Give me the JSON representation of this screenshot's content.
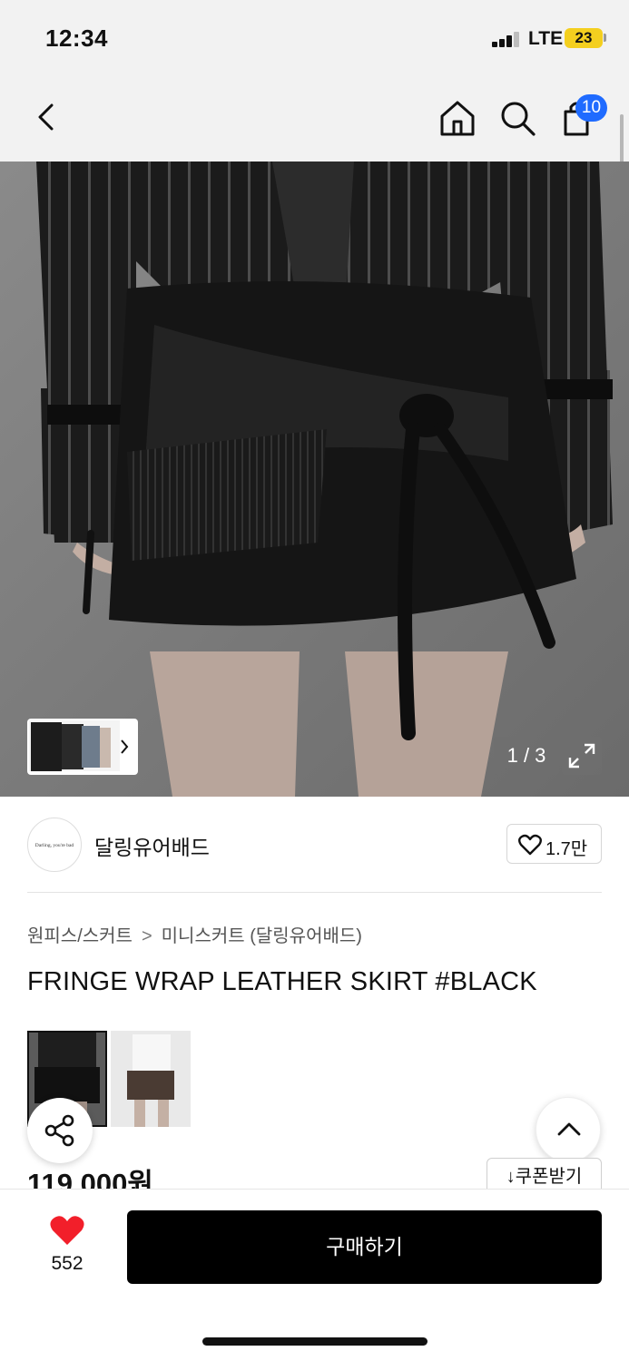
{
  "status_bar": {
    "time": "12:34",
    "network": "LTE",
    "battery": "23"
  },
  "nav": {
    "back_icon": "chevron-left-icon",
    "home_icon": "home-icon",
    "search_icon": "search-icon",
    "cart_icon": "shopping-bag-icon",
    "cart_count": "10",
    "badge_color": "#1f6bff"
  },
  "gallery": {
    "pager": "1 / 3",
    "expand_icon": "expand-icon",
    "more_icon": "chevron-right-icon"
  },
  "brand": {
    "logo_text": "Darling, you're bad",
    "name": "달링유어배드",
    "like_icon": "heart-outline-icon",
    "like_count": "1.7만"
  },
  "breadcrumb": {
    "category": "원피스/스커트",
    "separator": ">",
    "subcategory": "미니스커트 (달링유어배드)"
  },
  "product": {
    "title": "FRINGE WRAP LEATHER SKIRT #BLACK",
    "price": "119,000원",
    "coupon_label": "↓쿠폰받기"
  },
  "floating": {
    "share_icon": "share-icon",
    "top_icon": "chevron-up-icon"
  },
  "bottom_bar": {
    "wish_icon": "heart-filled-icon",
    "wish_count": "552",
    "buy_label": "구매하기",
    "heart_color": "#f21f2a"
  }
}
